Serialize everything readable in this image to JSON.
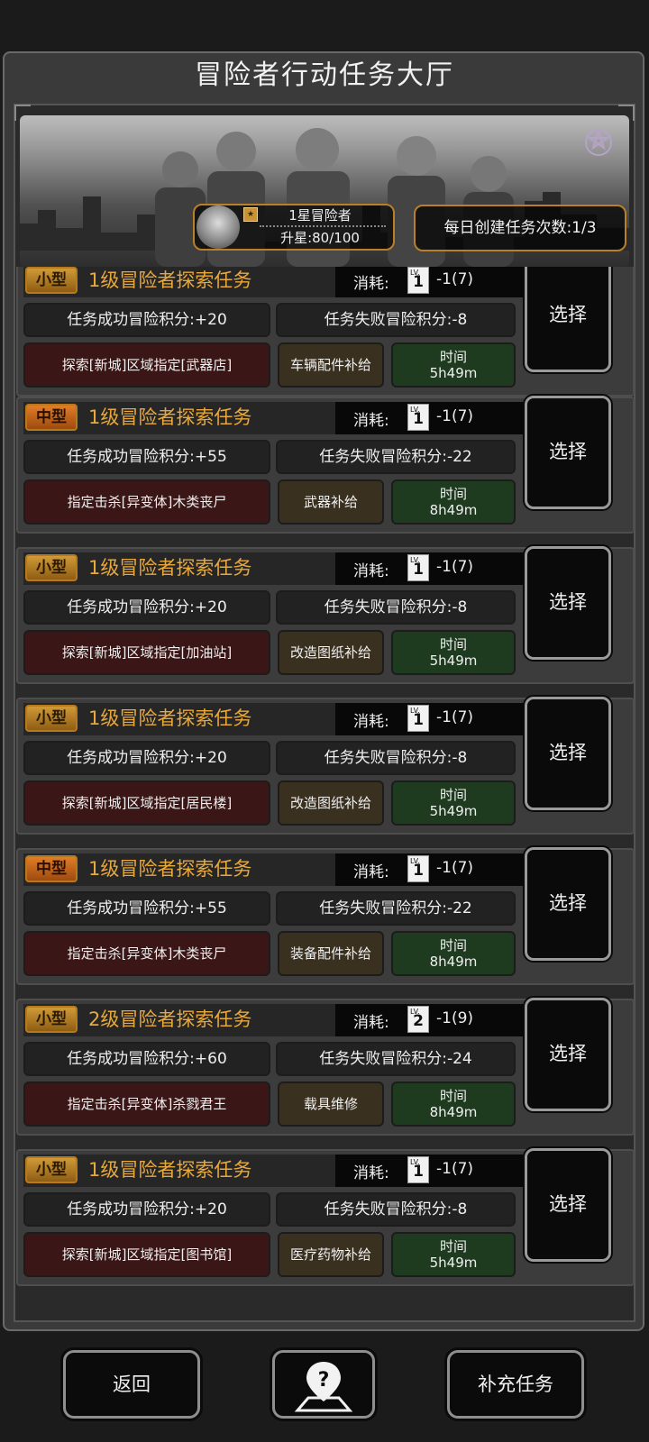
{
  "header": {
    "title": "冒险者行动任务大厅"
  },
  "banner": {
    "rank_label": "1星冒险者",
    "star_progress": "升星:80/100",
    "daily_create": "每日创建任务次数:1/3"
  },
  "tasks": [
    {
      "size": "小型",
      "name": "1级冒险者探索任务",
      "cost_label": "消耗:",
      "ticket_level": "1",
      "cost_value": "-1(7)",
      "success": "任务成功冒险积分:+20",
      "fail": "任务失败冒险积分:-8",
      "zone": "探索[新城]区域指定[武器店]",
      "reward": "车辆配件补给",
      "time_label": "时间",
      "time_value": "5h49m",
      "select": "选择"
    },
    {
      "size": "中型",
      "name": "1级冒险者探索任务",
      "cost_label": "消耗:",
      "ticket_level": "1",
      "cost_value": "-1(7)",
      "success": "任务成功冒险积分:+55",
      "fail": "任务失败冒险积分:-22",
      "zone": "指定击杀[异变体]木类丧尸",
      "reward": "武器补给",
      "time_label": "时间",
      "time_value": "8h49m",
      "select": "选择"
    },
    {
      "size": "小型",
      "name": "1级冒险者探索任务",
      "cost_label": "消耗:",
      "ticket_level": "1",
      "cost_value": "-1(7)",
      "success": "任务成功冒险积分:+20",
      "fail": "任务失败冒险积分:-8",
      "zone": "探索[新城]区域指定[加油站]",
      "reward": "改造图纸补给",
      "time_label": "时间",
      "time_value": "5h49m",
      "select": "选择"
    },
    {
      "size": "小型",
      "name": "1级冒险者探索任务",
      "cost_label": "消耗:",
      "ticket_level": "1",
      "cost_value": "-1(7)",
      "success": "任务成功冒险积分:+20",
      "fail": "任务失败冒险积分:-8",
      "zone": "探索[新城]区域指定[居民楼]",
      "reward": "改造图纸补给",
      "time_label": "时间",
      "time_value": "5h49m",
      "select": "选择"
    },
    {
      "size": "中型",
      "name": "1级冒险者探索任务",
      "cost_label": "消耗:",
      "ticket_level": "1",
      "cost_value": "-1(7)",
      "success": "任务成功冒险积分:+55",
      "fail": "任务失败冒险积分:-22",
      "zone": "指定击杀[异变体]木类丧尸",
      "reward": "装备配件补给",
      "time_label": "时间",
      "time_value": "8h49m",
      "select": "选择"
    },
    {
      "size": "小型",
      "name": "2级冒险者探索任务",
      "cost_label": "消耗:",
      "ticket_level": "2",
      "cost_value": "-1(9)",
      "success": "任务成功冒险积分:+60",
      "fail": "任务失败冒险积分:-24",
      "zone": "指定击杀[异变体]杀戮君王",
      "reward": "载具维修",
      "time_label": "时间",
      "time_value": "8h49m",
      "select": "选择"
    },
    {
      "size": "小型",
      "name": "1级冒险者探索任务",
      "cost_label": "消耗:",
      "ticket_level": "1",
      "cost_value": "-1(7)",
      "success": "任务成功冒险积分:+20",
      "fail": "任务失败冒险积分:-8",
      "zone": "探索[新城]区域指定[图书馆]",
      "reward": "医疗药物补给",
      "time_label": "时间",
      "time_value": "5h49m",
      "select": "选择"
    }
  ],
  "footer": {
    "back": "返回",
    "help_icon": "help-map-icon",
    "refill": "补充任务"
  },
  "colors": {
    "accent": "#e9a83a",
    "small_tag": "#d09a37",
    "medium_tag": "#e07d27",
    "zone_bg": "#3b1616",
    "time_bg": "#1f3b1f"
  }
}
